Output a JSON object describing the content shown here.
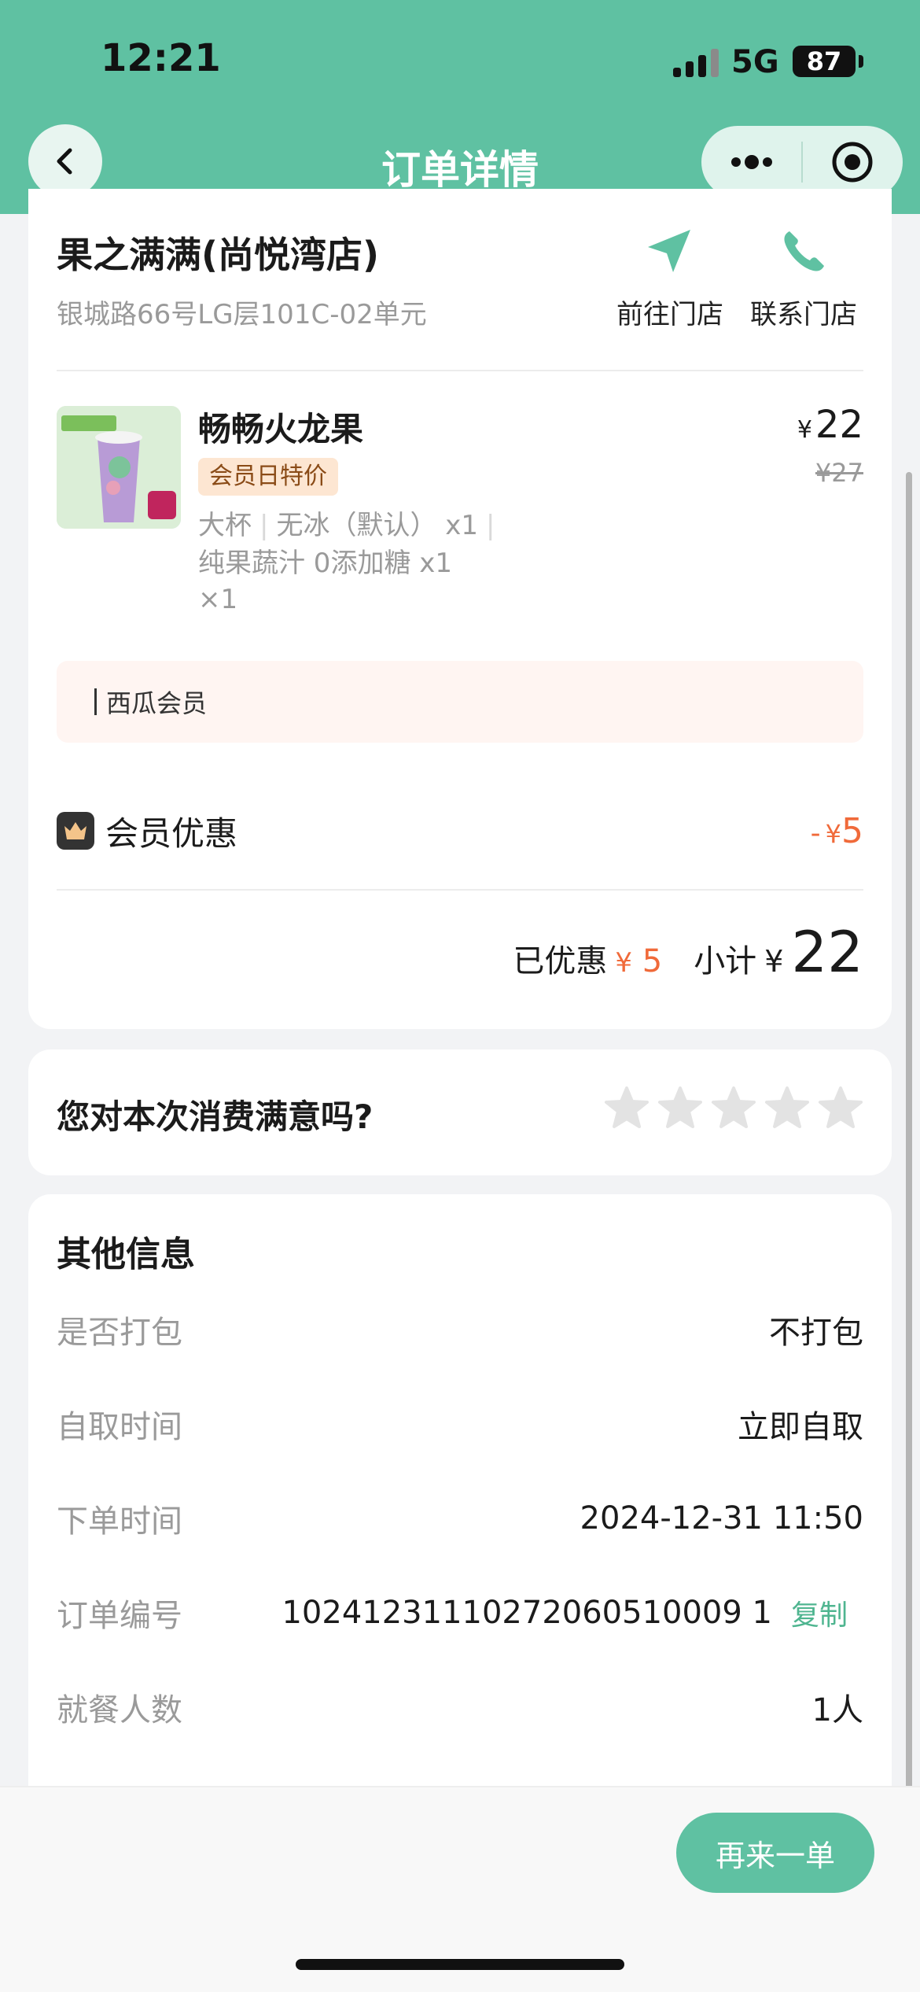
{
  "status_bar": {
    "time": "12:21",
    "network": "5G",
    "battery": "87"
  },
  "nav": {
    "title": "订单详情"
  },
  "store": {
    "name": "果之满满(尚悦湾店)",
    "address": "银城路66号LG层101C-02单元",
    "go_label": "前往门店",
    "call_label": "联系门店"
  },
  "product": {
    "name": "畅畅火龙果",
    "tag": "会员日特价",
    "spec_line1": [
      "大杯",
      "无冰（默认） x1"
    ],
    "spec_line2": "纯果蔬汁 0添加糖 x1",
    "quantity": "×1",
    "price_symbol": "¥",
    "price": "22",
    "original_price": "¥27"
  },
  "member_box": {
    "label": "西瓜会员"
  },
  "discount": {
    "label": "会员优惠",
    "minus": "-",
    "symbol": "¥",
    "amount": "5"
  },
  "totals": {
    "saved_label": "已优惠",
    "saved_symbol": "¥",
    "saved_amount": "5",
    "subtotal_label": "小计",
    "subtotal_symbol": "¥",
    "subtotal_amount": "22"
  },
  "rating": {
    "question": "您对本次消费满意吗?",
    "stars_filled": 0,
    "stars_total": 5
  },
  "other_info": {
    "title": "其他信息",
    "rows": [
      {
        "label": "是否打包",
        "value": "不打包"
      },
      {
        "label": "自取时间",
        "value": "立即自取"
      },
      {
        "label": "下单时间",
        "value": "2024-12-31 11:50"
      },
      {
        "label": "订单编号",
        "value": "10241231110272060510009 1",
        "copy": "复制"
      },
      {
        "label": "就餐人数",
        "value": "1人"
      }
    ]
  },
  "actions": {
    "reorder": "再来一单"
  },
  "colors": {
    "brand": "#5fc1a2",
    "discount": "#f06a3a",
    "tag_bg": "#fde6d2"
  }
}
